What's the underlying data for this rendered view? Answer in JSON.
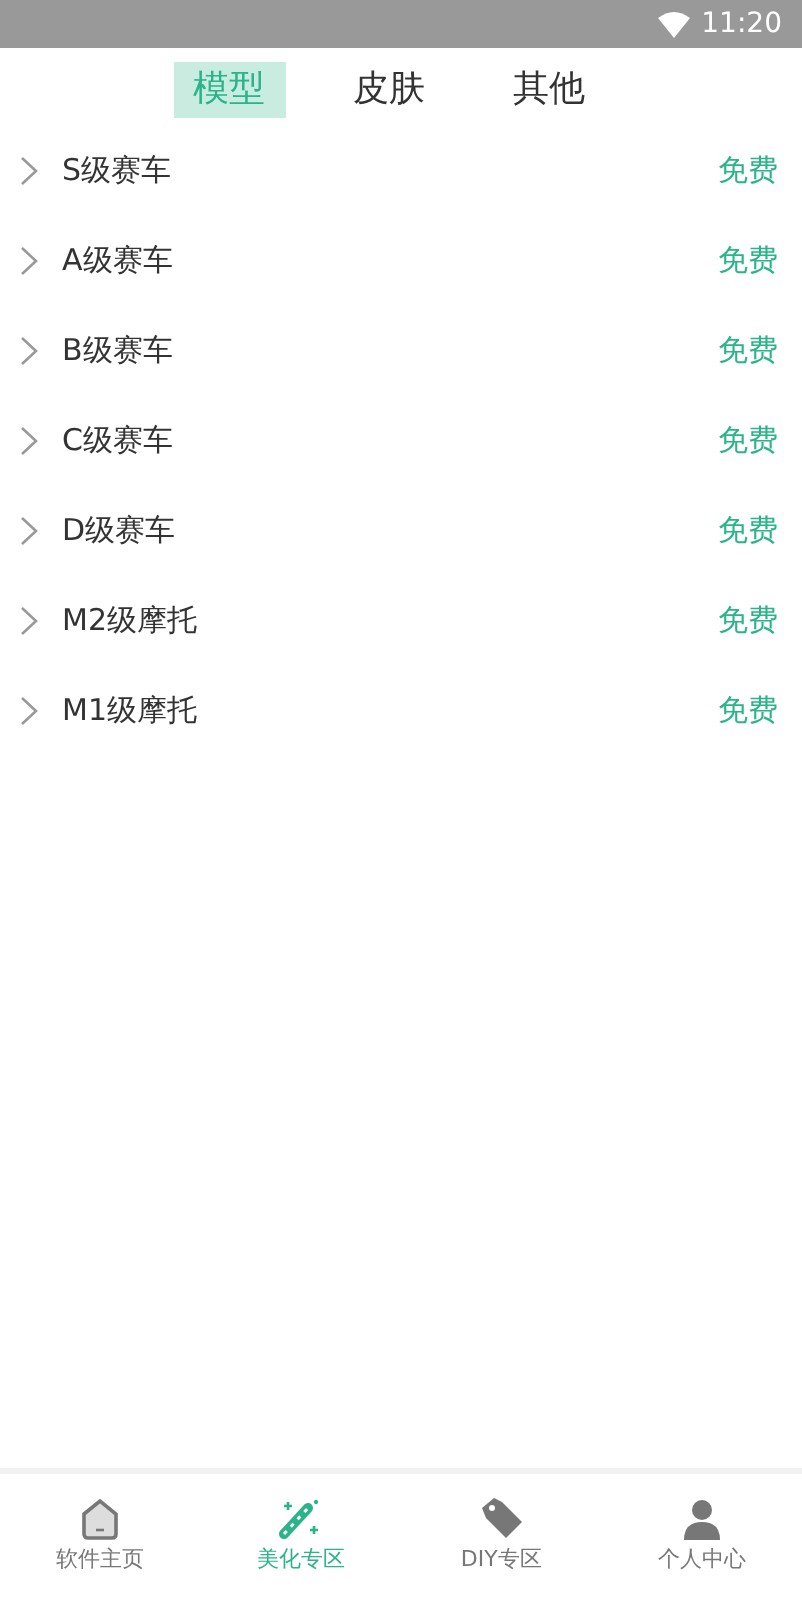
{
  "status_bar": {
    "time": "11:20"
  },
  "tabs": [
    {
      "label": "模型",
      "selected": true
    },
    {
      "label": "皮肤",
      "selected": false
    },
    {
      "label": "其他",
      "selected": false
    }
  ],
  "items": [
    {
      "name": "S级赛车",
      "price": "免费"
    },
    {
      "name": "A级赛车",
      "price": "免费"
    },
    {
      "name": "B级赛车",
      "price": "免费"
    },
    {
      "name": "C级赛车",
      "price": "免费"
    },
    {
      "name": "D级赛车",
      "price": "免费"
    },
    {
      "name": "M2级摩托",
      "price": "免费"
    },
    {
      "name": "M1级摩托",
      "price": "免费"
    }
  ],
  "bottom_nav": [
    {
      "kind": "home",
      "label": "软件主页",
      "selected": false
    },
    {
      "kind": "wand",
      "label": "美化专区",
      "selected": true
    },
    {
      "kind": "tag",
      "label": "DIY专区",
      "selected": false
    },
    {
      "kind": "person",
      "label": "个人中心",
      "selected": false
    }
  ]
}
